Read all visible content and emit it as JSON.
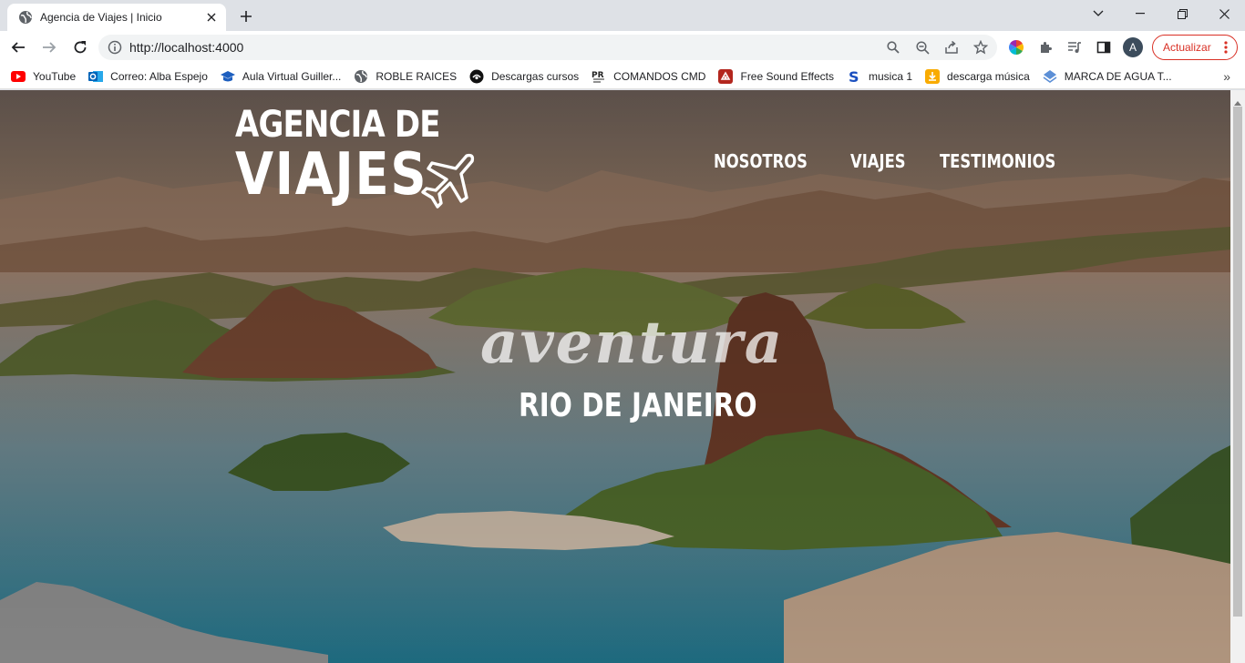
{
  "browser": {
    "tab_title": "Agencia de Viajes | Inicio",
    "url": "http://localhost:4000",
    "avatar_letter": "A",
    "update_label": "Actualizar",
    "accent": "#d93025"
  },
  "bookmarks": [
    {
      "label": "YouTube",
      "icon": "youtube-icon"
    },
    {
      "label": "Correo: Alba Espejo",
      "icon": "outlook-icon"
    },
    {
      "label": "Aula Virtual Guiller...",
      "icon": "graduation-cap-icon"
    },
    {
      "label": "ROBLE RAICES",
      "icon": "globe-icon"
    },
    {
      "label": "Descargas cursos",
      "icon": "download-circle-icon"
    },
    {
      "label": "COMANDOS CMD",
      "icon": "pr-logo-icon"
    },
    {
      "label": "Free Sound Effects",
      "icon": "sound-effects-icon"
    },
    {
      "label": "musica 1",
      "icon": "s-logo-icon"
    },
    {
      "label": "descarga música",
      "icon": "download-music-icon"
    },
    {
      "label": "MARCA DE AGUA T...",
      "icon": "watermark-icon"
    }
  ],
  "site": {
    "logo_line1": "AGENCIA DE",
    "logo_line2": "VIAJES",
    "nav": [
      "NOSOTROS",
      "VIAJES",
      "TESTIMONIOS"
    ],
    "tagline": "aventura",
    "heading": "RIO DE JANEIRO"
  }
}
